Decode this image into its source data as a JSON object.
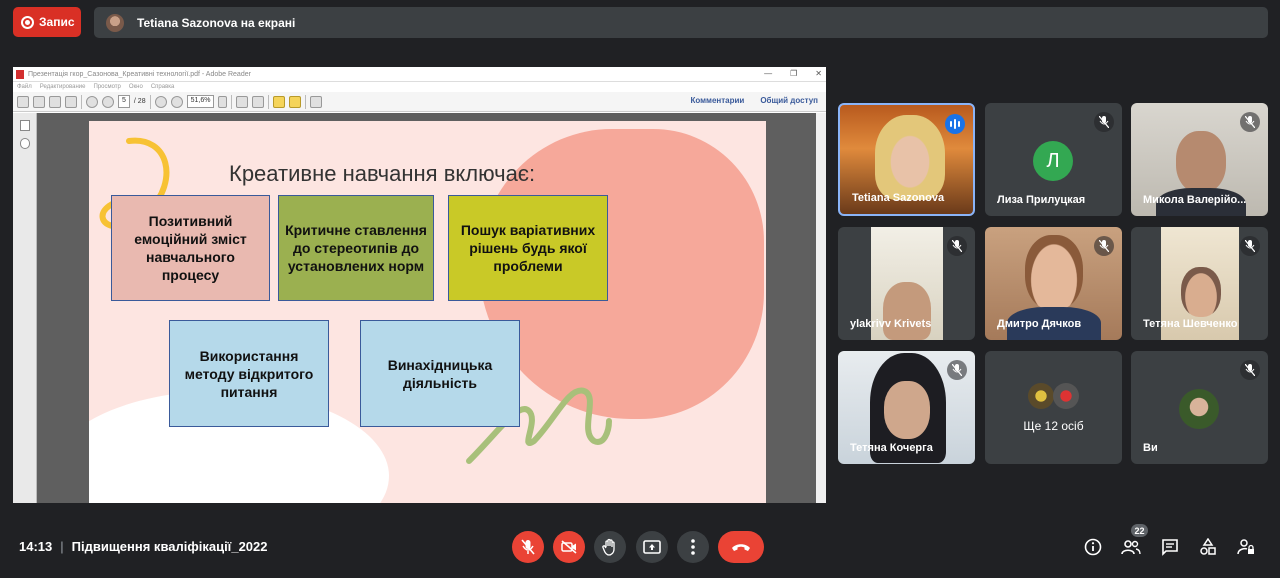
{
  "top": {
    "record_label": "Запис",
    "presenting_text": "Tetiana Sazonova на екрані"
  },
  "acrobat": {
    "title": "Презентація гкор_Сазонова_Креативні технології.pdf - Adobe Reader",
    "menu": [
      "Файл",
      "Редактирование",
      "Просмотр",
      "Окно",
      "Справка"
    ],
    "page_current": "5",
    "page_total": "/ 28",
    "zoom": "51,6%",
    "comments_label": "Комментарии",
    "share_label": "Общий доступ"
  },
  "slide": {
    "title": "Креативне навчання включає:",
    "boxes": [
      {
        "text": "Позитивний емоційний зміст навчального процесу",
        "color": "#e9b9b0"
      },
      {
        "text": "Критичне ставлення до стереотипів до установлених норм",
        "color": "#9bb050"
      },
      {
        "text": "Пошук варіативних рішень будь якої проблеми",
        "color": "#c9c927"
      },
      {
        "text": "Використання методу відкритого питання",
        "color": "#b5d9ea"
      },
      {
        "text": "Винахідницька діяльність",
        "color": "#b5d9ea"
      }
    ]
  },
  "participants": [
    {
      "name": "Tetiana Sazonova",
      "state": "speaking"
    },
    {
      "name": "Лиза Прилуцкая",
      "initial": "Л",
      "state": "muted"
    },
    {
      "name": "Микола Валерійо...",
      "state": "muted"
    },
    {
      "name": "ylakrivv Krivets",
      "state": "muted"
    },
    {
      "name": "Дмитро Дячков",
      "state": "muted"
    },
    {
      "name": "Тетяна Шевченко",
      "state": "muted"
    },
    {
      "name": "Тетяна Кочерга",
      "state": "muted"
    },
    {
      "name": "Ще 12 осіб"
    },
    {
      "name": "Ви",
      "state": "muted"
    }
  ],
  "bottom": {
    "time": "14:13",
    "separator": "|",
    "meeting_name": "Підвищення кваліфікації_2022",
    "people_count": "22"
  },
  "colors": {
    "accent_red": "#ea4335",
    "meet_bg": "#202124",
    "tile_bg": "#3c4043"
  }
}
